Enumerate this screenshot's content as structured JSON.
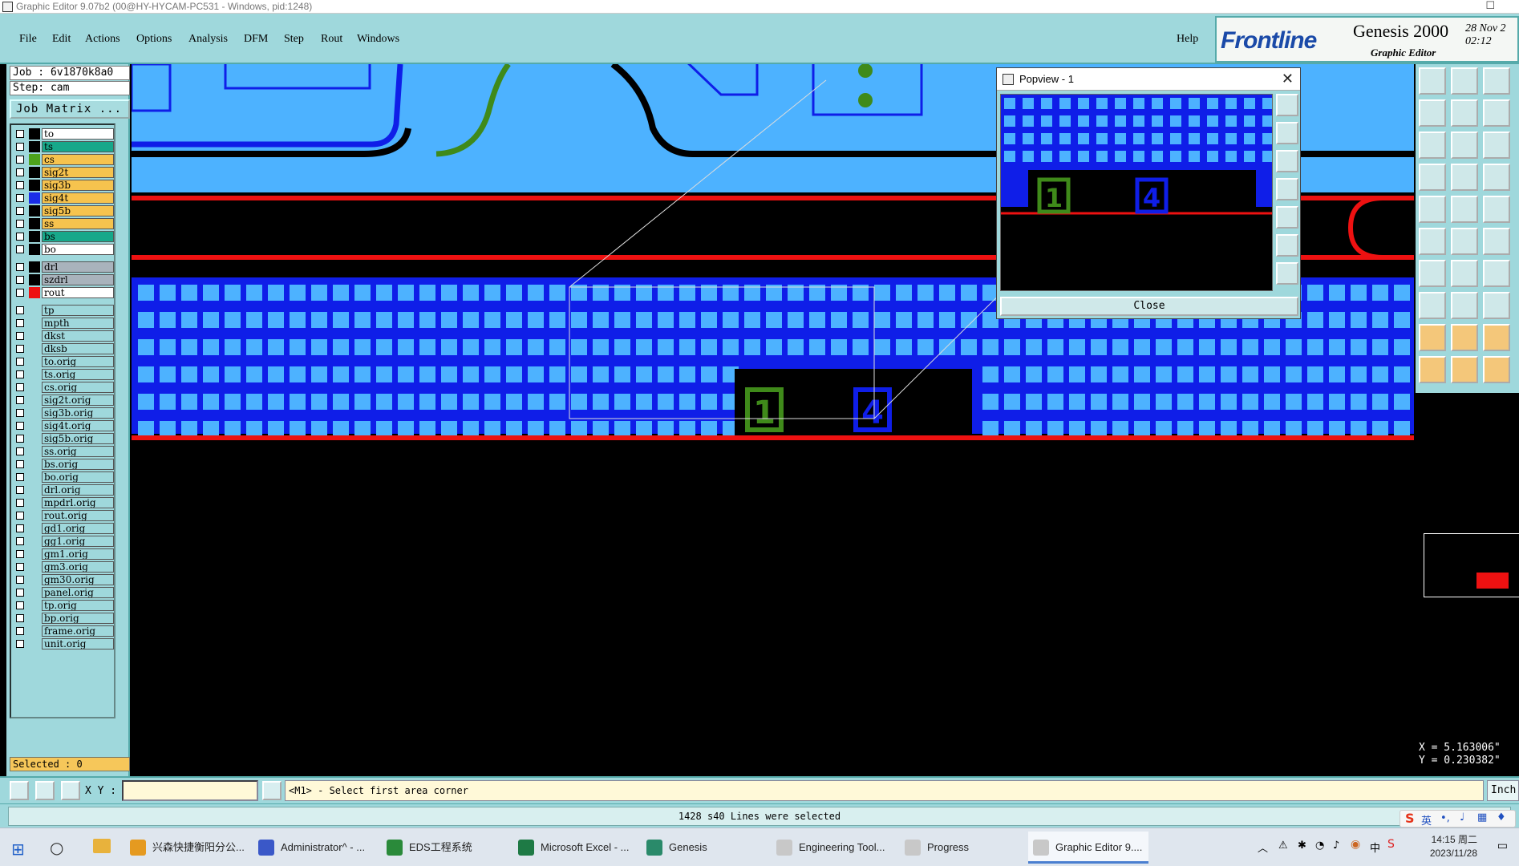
{
  "window": {
    "title": "Graphic Editor 9.07b2 (00@HY-HYCAM-PC531 - Windows, pid:1248)"
  },
  "menu": [
    {
      "label": "File",
      "key": "file"
    },
    {
      "label": "Edit",
      "key": "edit"
    },
    {
      "label": "Actions",
      "key": "actions"
    },
    {
      "label": "Options",
      "key": "options"
    },
    {
      "label": "Analysis",
      "key": "analysis"
    },
    {
      "label": "DFM",
      "key": "dfm"
    },
    {
      "label": "Step",
      "key": "step"
    },
    {
      "label": "Rout",
      "key": "rout"
    },
    {
      "label": "Windows",
      "key": "windows"
    },
    {
      "label": "Help",
      "key": "help"
    }
  ],
  "brand": {
    "logo": "Frontline",
    "product": "Genesis 2000",
    "subtitle": "Graphic Editor",
    "date": "28 Nov 2",
    "time": "02:12 "
  },
  "job": {
    "job_line": "Job : 6v1870k8a0",
    "step_line": "Step: cam",
    "matrix_button": "Job Matrix ..."
  },
  "layers": [
    {
      "name": "to",
      "bg": "#ffffff",
      "swatch": ""
    },
    {
      "name": "ts",
      "bg": "#17a88a",
      "swatch": ""
    },
    {
      "name": "cs",
      "bg": "#f6c34e",
      "swatch": "#4ca21c"
    },
    {
      "name": "sig2t",
      "bg": "#f6c34e",
      "swatch": ""
    },
    {
      "name": "sig3b",
      "bg": "#f6c34e",
      "swatch": ""
    },
    {
      "name": "sig4t",
      "bg": "#f6c34e",
      "swatch": "#1a2ee8"
    },
    {
      "name": "sig5b",
      "bg": "#f6c34e",
      "swatch": ""
    },
    {
      "name": "ss",
      "bg": "#f6c34e",
      "swatch": ""
    },
    {
      "name": "bs",
      "bg": "#17a88a",
      "swatch": ""
    },
    {
      "name": "bo",
      "bg": "#ffffff",
      "swatch": ""
    },
    {
      "name": "drl",
      "bg": "#a9b3bc",
      "swatch": ""
    },
    {
      "name": "szdrl",
      "bg": "#a9b3bc",
      "swatch": ""
    },
    {
      "name": "rout",
      "bg": "#ffffff",
      "swatch": "#ee1111"
    },
    {
      "name": "tp",
      "bg": "#9fd8dc",
      "swatch": ""
    },
    {
      "name": "mpth",
      "bg": "#9fd8dc",
      "swatch": ""
    },
    {
      "name": "dkst",
      "bg": "#9fd8dc",
      "swatch": ""
    },
    {
      "name": "dksb",
      "bg": "#9fd8dc",
      "swatch": ""
    },
    {
      "name": "to.orig",
      "bg": "#9fd8dc",
      "swatch": ""
    },
    {
      "name": "ts.orig",
      "bg": "#9fd8dc",
      "swatch": ""
    },
    {
      "name": "cs.orig",
      "bg": "#9fd8dc",
      "swatch": ""
    },
    {
      "name": "sig2t.orig",
      "bg": "#9fd8dc",
      "swatch": ""
    },
    {
      "name": "sig3b.orig",
      "bg": "#9fd8dc",
      "swatch": ""
    },
    {
      "name": "sig4t.orig",
      "bg": "#9fd8dc",
      "swatch": ""
    },
    {
      "name": "sig5b.orig",
      "bg": "#9fd8dc",
      "swatch": ""
    },
    {
      "name": "ss.orig",
      "bg": "#9fd8dc",
      "swatch": ""
    },
    {
      "name": "bs.orig",
      "bg": "#9fd8dc",
      "swatch": ""
    },
    {
      "name": "bo.orig",
      "bg": "#9fd8dc",
      "swatch": ""
    },
    {
      "name": "drl.orig",
      "bg": "#9fd8dc",
      "swatch": ""
    },
    {
      "name": "mpdrl.orig",
      "bg": "#9fd8dc",
      "swatch": ""
    },
    {
      "name": "rout.orig",
      "bg": "#9fd8dc",
      "swatch": ""
    },
    {
      "name": "gd1.orig",
      "bg": "#9fd8dc",
      "swatch": ""
    },
    {
      "name": "gg1.orig",
      "bg": "#9fd8dc",
      "swatch": ""
    },
    {
      "name": "gm1.orig",
      "bg": "#9fd8dc",
      "swatch": ""
    },
    {
      "name": "gm3.orig",
      "bg": "#9fd8dc",
      "swatch": ""
    },
    {
      "name": "gm30.orig",
      "bg": "#9fd8dc",
      "swatch": ""
    },
    {
      "name": "panel.orig",
      "bg": "#9fd8dc",
      "swatch": ""
    },
    {
      "name": "tp.orig",
      "bg": "#9fd8dc",
      "swatch": ""
    },
    {
      "name": "bp.orig",
      "bg": "#9fd8dc",
      "swatch": ""
    },
    {
      "name": "frame.orig",
      "bg": "#9fd8dc",
      "swatch": ""
    },
    {
      "name": "unit.orig",
      "bg": "#9fd8dc",
      "swatch": ""
    }
  ],
  "selected_label": "Selected : 0",
  "canvas": {
    "colors": {
      "copper_light": "#4db2ff",
      "copper_dark": "#0f1ee8",
      "outline": "#ee1111",
      "green": "#3f8a1a"
    },
    "labels": {
      "pad_left": "1",
      "pad_right": "4"
    }
  },
  "popview": {
    "title": "Popview - 1",
    "close_label": "Close",
    "pad_left": "1",
    "pad_right": "4"
  },
  "coords": {
    "x": "X = 5.163006\"",
    "y": "Y = 0.230382\""
  },
  "bottom": {
    "xy_label": "X Y :",
    "xy_value": "",
    "prompt": "<M1> - Select first area corner",
    "unit": "Inch"
  },
  "status": "1428 s40 Lines were selected",
  "taskbar": [
    {
      "label": "兴森快捷衡阳分公...",
      "color": "#e59a20"
    },
    {
      "label": "Administrator^ - ...",
      "color": "#3a58c8"
    },
    {
      "label": "EDS工程系统",
      "color": "#2a8a3a"
    },
    {
      "label": "Microsoft Excel - ...",
      "color": "#1e7a45"
    },
    {
      "label": "Genesis",
      "color": "#2a8a6a"
    },
    {
      "label": "Engineering Tool...",
      "color": "#c8c8c8"
    },
    {
      "label": "Progress",
      "color": "#c8c8c8"
    },
    {
      "label": "Graphic Editor 9....",
      "color": "#c8c8c8"
    }
  ],
  "tray": {
    "ime": "英",
    "lang": "中",
    "time": "14:15 周二",
    "date": "2023/11/28"
  }
}
